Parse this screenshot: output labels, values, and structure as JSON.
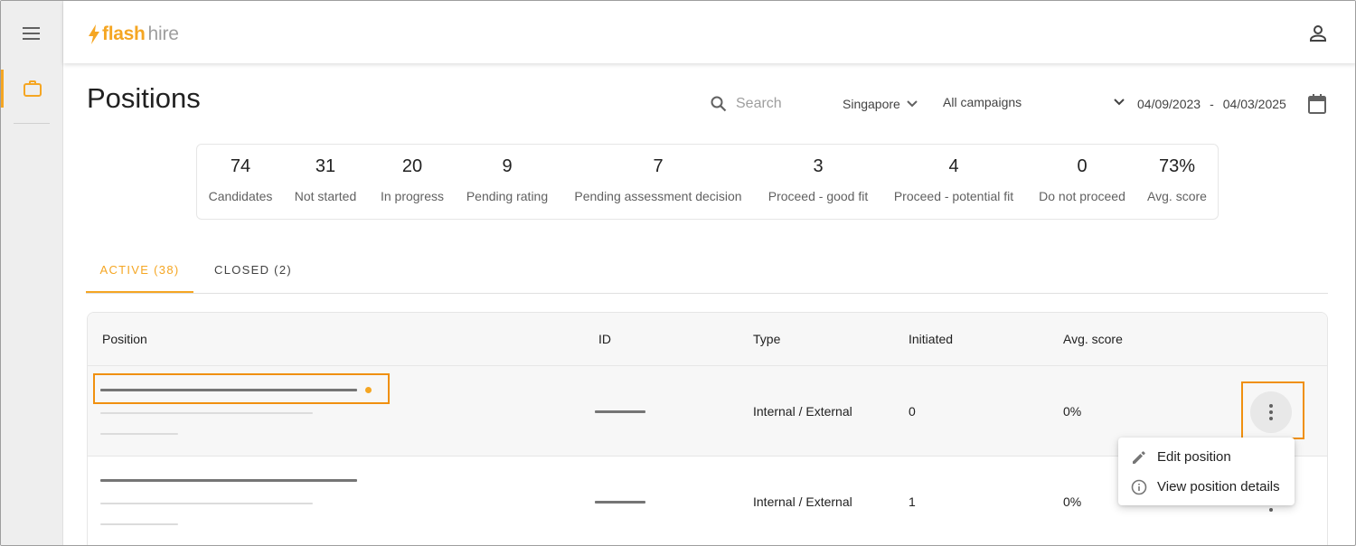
{
  "app": {
    "logo_brand": "flash",
    "logo_suffix": "hire",
    "accent_color": "#f5a623",
    "icons": {
      "menu": "hamburger-menu-icon",
      "positions": "briefcase-icon",
      "account": "person-icon",
      "search": "search-icon",
      "calendar": "calendar-icon"
    }
  },
  "page": {
    "title": "Positions"
  },
  "filters": {
    "search_placeholder": "Search",
    "country": "Singapore",
    "campaign": "All campaigns",
    "date_from": "04/09/2023",
    "date_separator": "-",
    "date_to": "04/03/2025"
  },
  "stats": [
    {
      "value": "74",
      "label": "Candidates"
    },
    {
      "value": "31",
      "label": "Not started"
    },
    {
      "value": "20",
      "label": "In progress"
    },
    {
      "value": "9",
      "label": "Pending rating"
    },
    {
      "value": "7",
      "label": "Pending assessment decision"
    },
    {
      "value": "3",
      "label": "Proceed - good fit"
    },
    {
      "value": "4",
      "label": "Proceed - potential fit"
    },
    {
      "value": "0",
      "label": "Do not proceed"
    },
    {
      "value": "73%",
      "label": "Avg. score"
    }
  ],
  "tabs": [
    {
      "label": "ACTIVE (38)",
      "active": true
    },
    {
      "label": "CLOSED (2)",
      "active": false
    }
  ],
  "table": {
    "columns": [
      "Position",
      "ID",
      "Type",
      "Initiated",
      "Avg. score"
    ],
    "rows": [
      {
        "type": "Internal / External",
        "initiated": "0",
        "avg_score": "0%"
      },
      {
        "type": "Internal / External",
        "initiated": "1",
        "avg_score": "0%"
      }
    ]
  },
  "row_menu": {
    "items": [
      {
        "label": "Edit position",
        "icon": "pencil-icon"
      },
      {
        "label": "View position details",
        "icon": "info-icon"
      }
    ]
  }
}
